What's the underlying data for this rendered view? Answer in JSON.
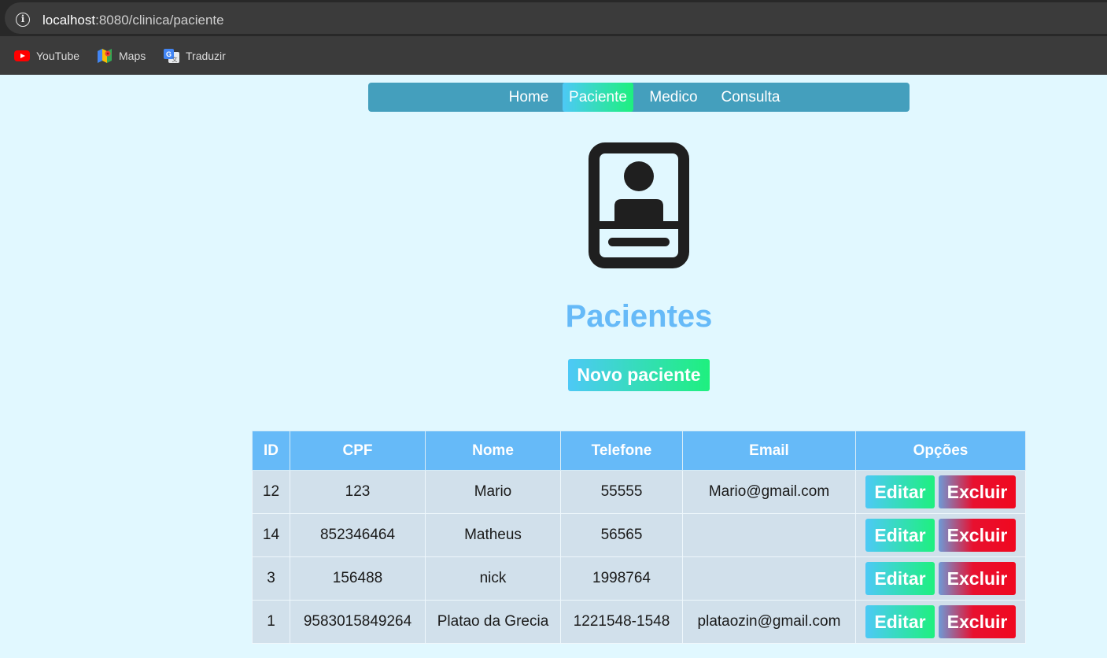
{
  "browser": {
    "url_host": "localhost",
    "url_rest": ":8080/clinica/paciente",
    "bookmarks": [
      {
        "label": "YouTube",
        "icon": "youtube-icon"
      },
      {
        "label": "Maps",
        "icon": "maps-icon"
      },
      {
        "label": "Traduzir",
        "icon": "translate-icon"
      }
    ]
  },
  "nav": {
    "items": [
      "Home",
      "Paciente",
      "Medico",
      "Consulta"
    ],
    "active": "Paciente",
    "color": "#449fbd"
  },
  "header": {
    "icon": "patient-card-icon",
    "title": "Pacientes",
    "new_button": "Novo paciente"
  },
  "table": {
    "columns": [
      "ID",
      "CPF",
      "Nome",
      "Telefone",
      "Email",
      "Opções"
    ],
    "rows": [
      {
        "id": "12",
        "cpf": "123",
        "nome": "Mario",
        "telefone": "55555",
        "email": "Mario@gmail.com"
      },
      {
        "id": "14",
        "cpf": "852346464",
        "nome": "Matheus",
        "telefone": "56565",
        "email": ""
      },
      {
        "id": "3",
        "cpf": "156488",
        "nome": "nick",
        "telefone": "1998764",
        "email": ""
      },
      {
        "id": "1",
        "cpf": "9583015849264",
        "nome": "Platao da Grecia",
        "telefone": "1221548-1548",
        "email": "plataozin@gmail.com"
      }
    ],
    "edit_label": "Editar",
    "delete_label": "Excluir"
  },
  "colors": {
    "background": "#e1f8ff",
    "accent": "#66baf8",
    "gradient_start": "#4dc9f6",
    "gradient_end": "#1ef07e",
    "danger": "#e8102f"
  }
}
